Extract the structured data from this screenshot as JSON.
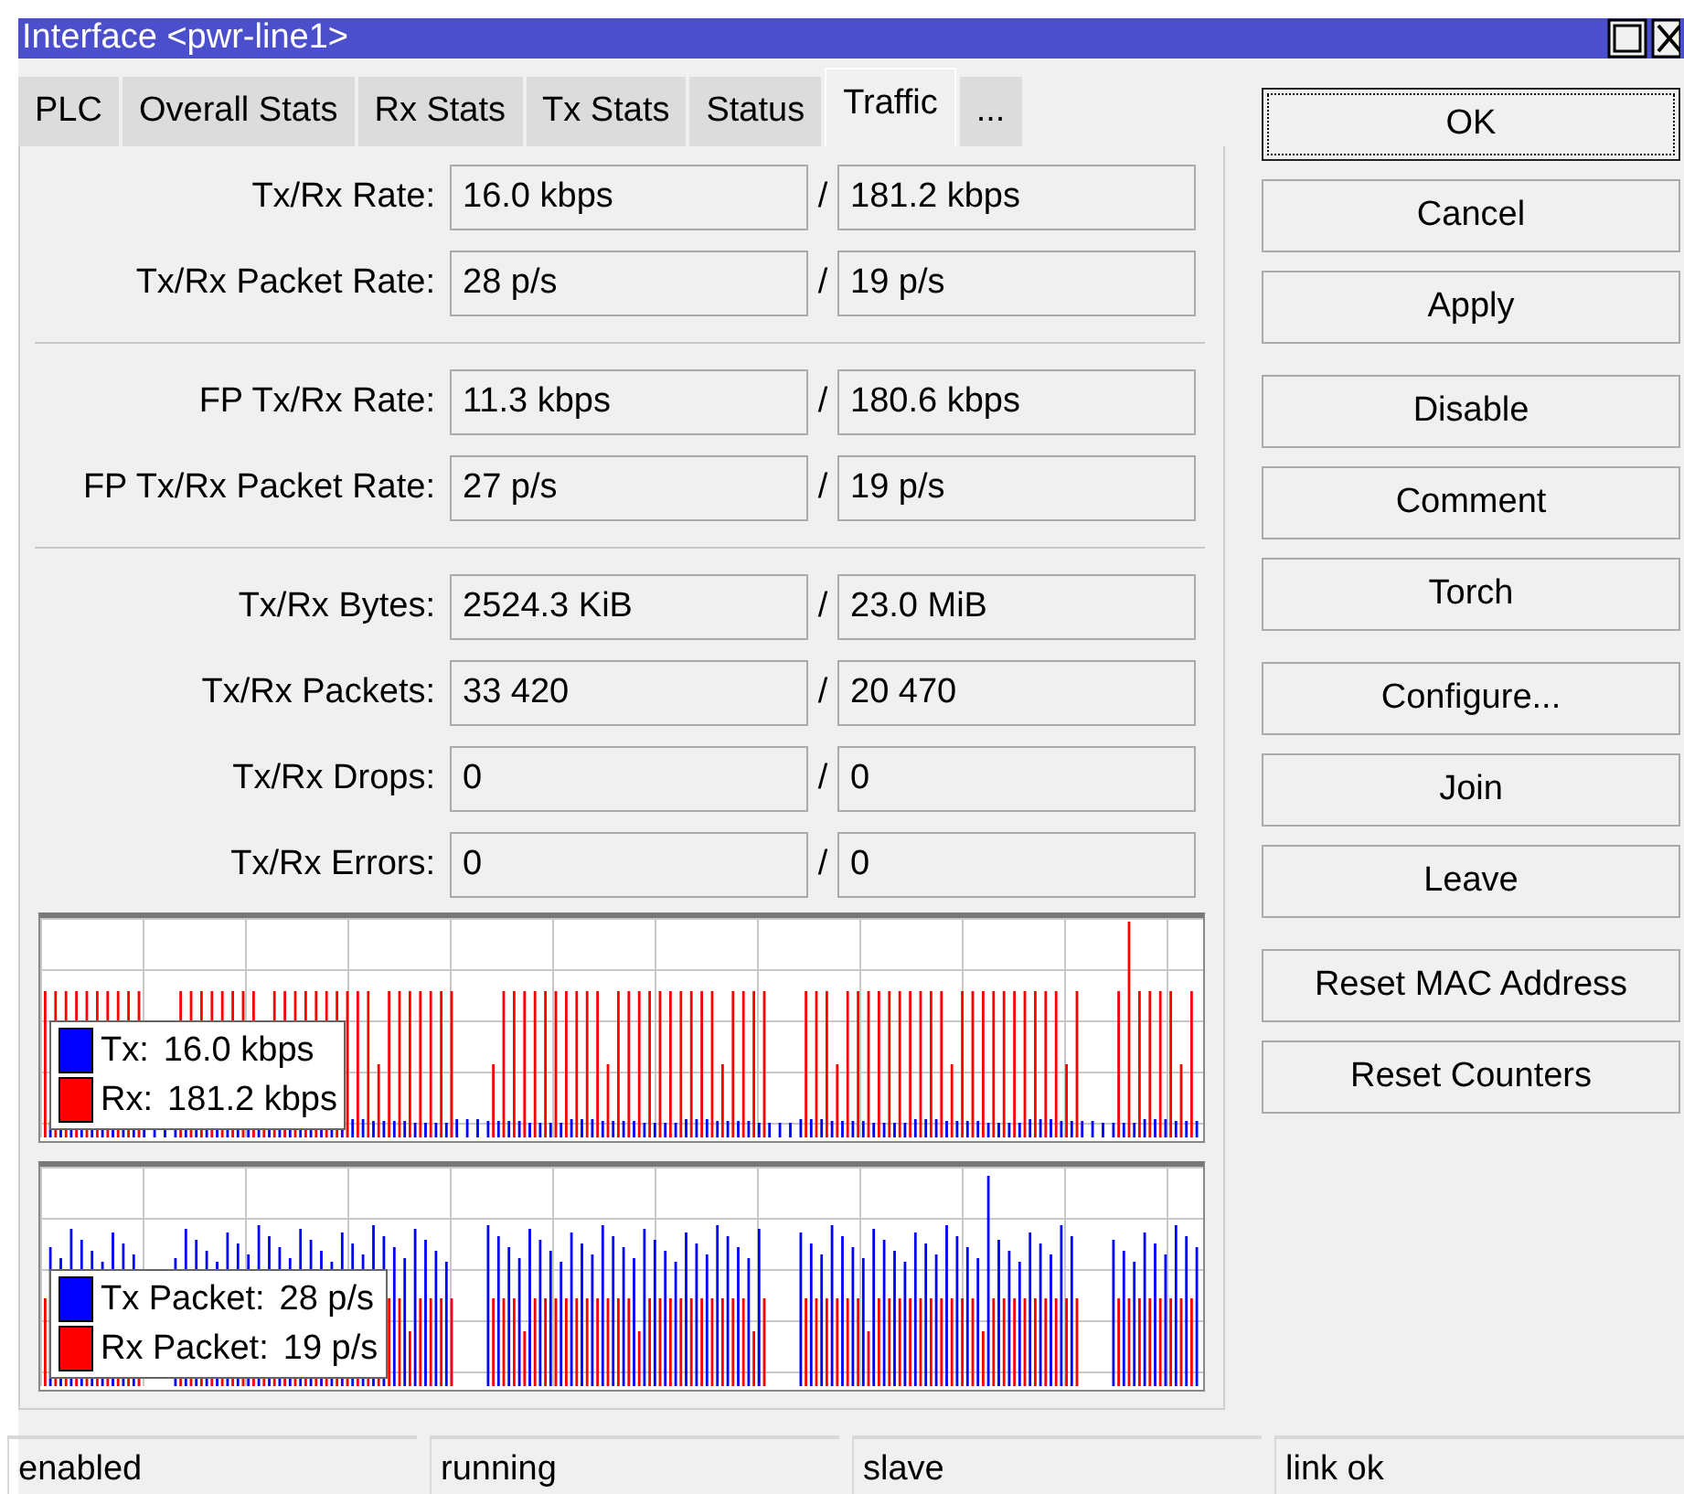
{
  "window": {
    "title": "Interface <pwr-line1>"
  },
  "tabs": [
    {
      "label": "PLC",
      "selected": false
    },
    {
      "label": "Overall Stats",
      "selected": false
    },
    {
      "label": "Rx Stats",
      "selected": false
    },
    {
      "label": "Tx Stats",
      "selected": false
    },
    {
      "label": "Status",
      "selected": false
    },
    {
      "label": "Traffic",
      "selected": true
    },
    {
      "label": "...",
      "selected": false
    }
  ],
  "field_groups": [
    [
      {
        "label": "Tx/Rx Rate:",
        "tx": "16.0 kbps",
        "rx": "181.2 kbps"
      },
      {
        "label": "Tx/Rx Packet Rate:",
        "tx": "28 p/s",
        "rx": "19 p/s"
      }
    ],
    [
      {
        "label": "FP Tx/Rx Rate:",
        "tx": "11.3 kbps",
        "rx": "180.6 kbps"
      },
      {
        "label": "FP Tx/Rx Packet Rate:",
        "tx": "27 p/s",
        "rx": "19 p/s"
      }
    ],
    [
      {
        "label": "Tx/Rx Bytes:",
        "tx": "2524.3 KiB",
        "rx": "23.0 MiB"
      },
      {
        "label": "Tx/Rx Packets:",
        "tx": "33 420",
        "rx": "20 470"
      },
      {
        "label": "Tx/Rx Drops:",
        "tx": "0",
        "rx": "0"
      },
      {
        "label": "Tx/Rx Errors:",
        "tx": "0",
        "rx": "0"
      }
    ]
  ],
  "separator": "/",
  "graphs": [
    {
      "series": [
        {
          "label": "Tx:",
          "value": "16.0 kbps",
          "color": "#0000ff"
        },
        {
          "label": "Rx:",
          "value": "181.2 kbps",
          "color": "#ff0000"
        }
      ]
    },
    {
      "series": [
        {
          "label": "Tx Packet:",
          "value": "28 p/s",
          "color": "#0000ff"
        },
        {
          "label": "Rx Packet:",
          "value": "19 p/s",
          "color": "#ff0000"
        }
      ]
    }
  ],
  "button_groups": [
    [
      {
        "label": "OK",
        "default": true
      },
      {
        "label": "Cancel",
        "default": false
      },
      {
        "label": "Apply",
        "default": false
      }
    ],
    [
      {
        "label": "Disable",
        "default": false
      },
      {
        "label": "Comment",
        "default": false
      },
      {
        "label": "Torch",
        "default": false
      }
    ],
    [
      {
        "label": "Configure...",
        "default": false
      },
      {
        "label": "Join",
        "default": false
      },
      {
        "label": "Leave",
        "default": false
      }
    ],
    [
      {
        "label": "Reset MAC Address",
        "default": false
      },
      {
        "label": "Reset Counters",
        "default": false
      }
    ]
  ],
  "status_bar": [
    "enabled",
    "running",
    "slave",
    "link ok"
  ]
}
